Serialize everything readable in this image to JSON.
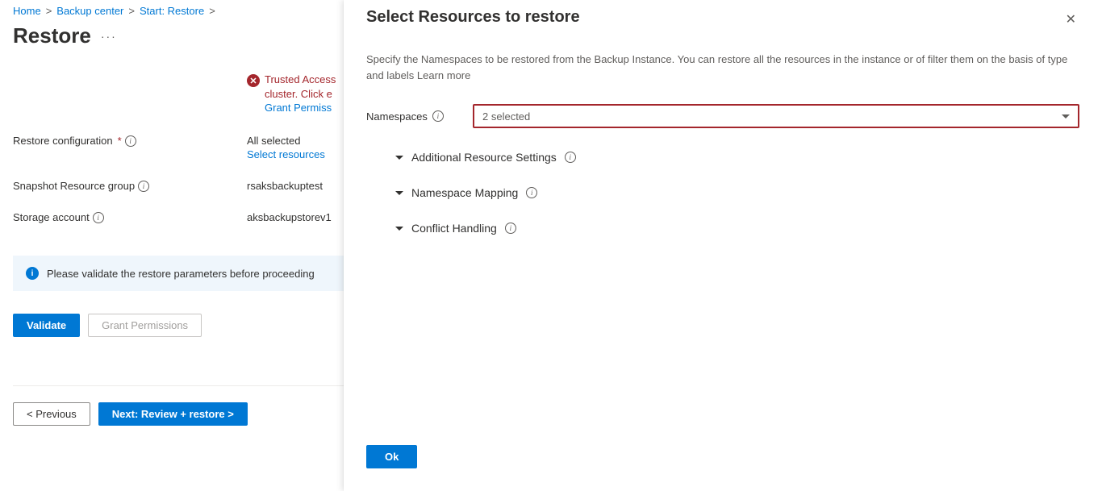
{
  "breadcrumb": {
    "items": [
      "Home",
      "Backup center",
      "Start: Restore"
    ],
    "separator": ">"
  },
  "page": {
    "title": "Restore",
    "ellipsis": "···"
  },
  "error": {
    "text_line1": "Trusted Access",
    "text_line2": "cluster. Click e",
    "link": "Grant Permiss"
  },
  "fields": {
    "restore_config": {
      "label": "Restore configuration",
      "required": "*",
      "value": "All selected",
      "link": "Select resources"
    },
    "snapshot_rg": {
      "label": "Snapshot Resource group",
      "value": "rsaksbackuptest"
    },
    "storage_account": {
      "label": "Storage account",
      "value": "aksbackupstorev1"
    }
  },
  "info_bar": {
    "text": "Please validate the restore parameters before proceeding"
  },
  "buttons": {
    "validate": "Validate",
    "grant": "Grant Permissions",
    "previous": "< Previous",
    "next": "Next: Review + restore >"
  },
  "panel": {
    "title": "Select Resources to restore",
    "description": "Specify the Namespaces to be restored from the Backup Instance. You can restore all the resources in the instance or of filter them on the basis of type and labels Learn more",
    "namespaces_label": "Namespaces",
    "namespaces_value": "2 selected",
    "expand1": "Additional Resource Settings",
    "expand2": "Namespace Mapping",
    "expand3": "Conflict Handling",
    "ok": "Ok"
  }
}
